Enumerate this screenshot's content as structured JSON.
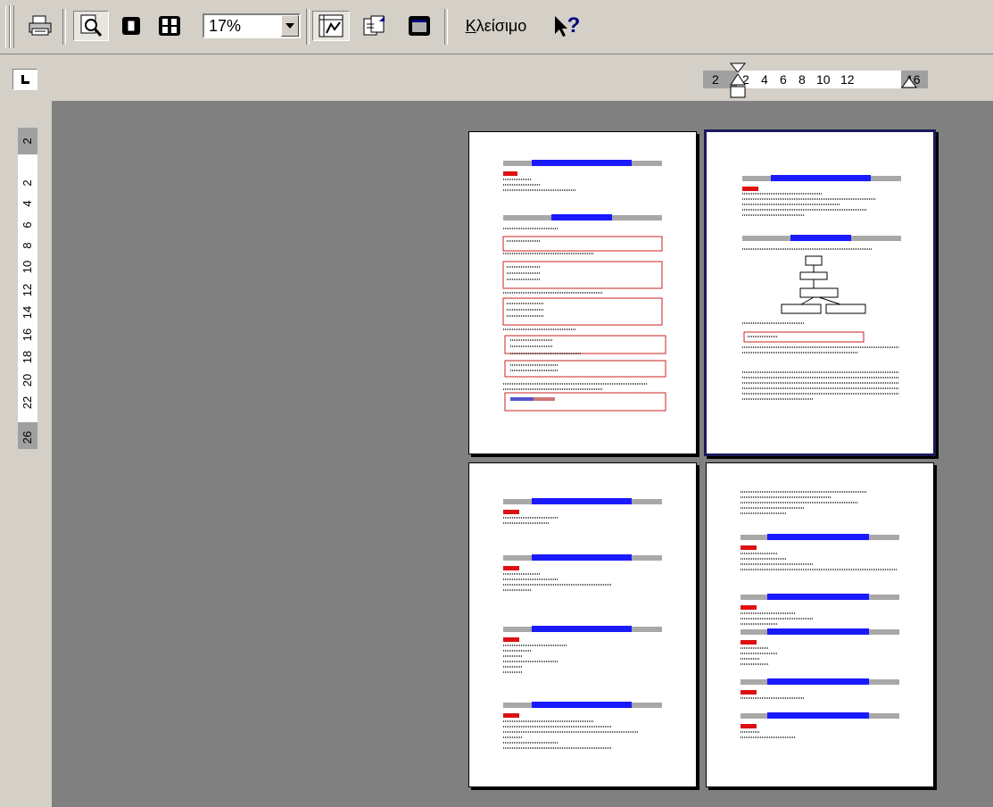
{
  "toolbar": {
    "zoom_value": "17%",
    "close_label_first": "Κ",
    "close_label_rest": "λείσιμο",
    "help_label": "?"
  },
  "ruler": {
    "horizontal_ticks": [
      "2",
      "2",
      "4",
      "6",
      "8",
      "10",
      "12",
      "16"
    ],
    "vertical_ticks": [
      "2",
      "2",
      "4",
      "6",
      "8",
      "10",
      "12",
      "14",
      "16",
      "18",
      "20",
      "22",
      "26"
    ]
  },
  "colors": {
    "heading_blue": "#1a1aff",
    "heading_gray": "#a8a8a8",
    "accent_red": "#dd1111",
    "box_red": "#cc2222",
    "workspace": "#808080"
  }
}
